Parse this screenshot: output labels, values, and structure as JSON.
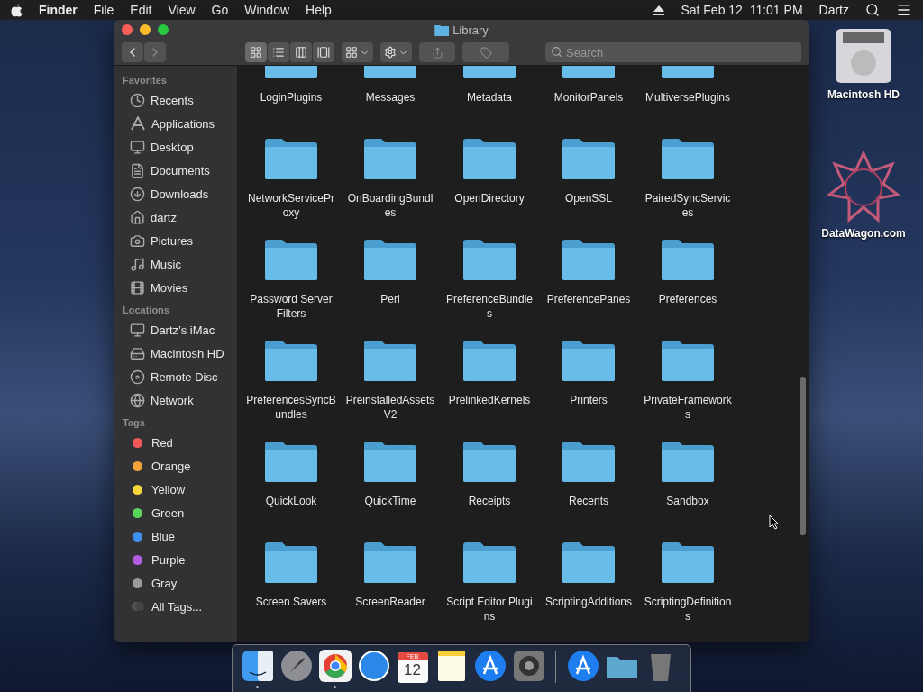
{
  "menu_bar": {
    "app": "Finder",
    "menus": [
      "File",
      "Edit",
      "View",
      "Go",
      "Window",
      "Help"
    ],
    "clock": "Sat Feb 12  11:01 PM",
    "user": "Dartz"
  },
  "window": {
    "title": "Library",
    "search": {
      "placeholder": "Search"
    },
    "view_modes": [
      {
        "selected": true
      },
      {
        "selected": false
      },
      {
        "selected": false
      },
      {
        "selected": false
      }
    ]
  },
  "sidebar": [
    {
      "heading": "Favorites",
      "items": [
        {
          "label": "Recents"
        },
        {
          "label": "Applications"
        },
        {
          "label": "Desktop"
        },
        {
          "label": "Documents"
        },
        {
          "label": "Downloads"
        },
        {
          "label": "dartz"
        },
        {
          "label": "Pictures"
        },
        {
          "label": "Music"
        },
        {
          "label": "Movies"
        }
      ]
    },
    {
      "heading": "Locations",
      "items": [
        {
          "label": "Dartz’s iMac"
        },
        {
          "label": "Macintosh HD"
        },
        {
          "label": "Remote Disc"
        },
        {
          "label": "Network"
        }
      ]
    },
    {
      "heading": "Tags",
      "items": [
        {
          "label": "Red",
          "color": "#f0585a"
        },
        {
          "label": "Orange",
          "color": "#f4a33b"
        },
        {
          "label": "Yellow",
          "color": "#f5d63a"
        },
        {
          "label": "Green",
          "color": "#5ad55c"
        },
        {
          "label": "Blue",
          "color": "#3d8ff0"
        },
        {
          "label": "Purple",
          "color": "#b45de0"
        },
        {
          "label": "Gray",
          "color": "#9a9a9c"
        },
        {
          "label": "All Tags..."
        }
      ]
    }
  ],
  "folders": [
    "LoginPlugins",
    "Messages",
    "Metadata",
    "MonitorPanels",
    "MultiversePlugins",
    "NetworkServiceProxy",
    "OnBoardingBundles",
    "OpenDirectory",
    "OpenSSL",
    "PairedSyncServices",
    "Password Server Filters",
    "Perl",
    "PreferenceBundles",
    "PreferencePanes",
    "Preferences",
    "PreferencesSyncBundles",
    "PreinstalledAssetsV2",
    "PrelinkedKernels",
    "Printers",
    "PrivateFrameworks",
    "QuickLook",
    "QuickTime",
    "Receipts",
    "Recents",
    "Sandbox",
    "Screen Savers",
    "ScreenReader",
    "Script Editor Plugins",
    "ScriptingAdditions",
    "ScriptingDefinitions"
  ],
  "desktop_icons": [
    {
      "label": "Macintosh HD"
    },
    {
      "label": "DataWagon.com"
    }
  ],
  "dock": [
    {
      "kind": "finder",
      "running": true
    },
    {
      "kind": "rocket",
      "running": false
    },
    {
      "kind": "chrome",
      "running": true
    },
    {
      "kind": "safari",
      "running": false
    },
    {
      "kind": "calendar",
      "running": false,
      "month": "FEB",
      "day": "12"
    },
    {
      "kind": "notes",
      "running": false
    },
    {
      "kind": "appstore",
      "running": false
    },
    {
      "kind": "gear",
      "running": false
    },
    {
      "kind": "separator"
    },
    {
      "kind": "appstore",
      "running": false
    },
    {
      "kind": "folder",
      "running": false
    },
    {
      "kind": "trash",
      "running": false
    }
  ]
}
